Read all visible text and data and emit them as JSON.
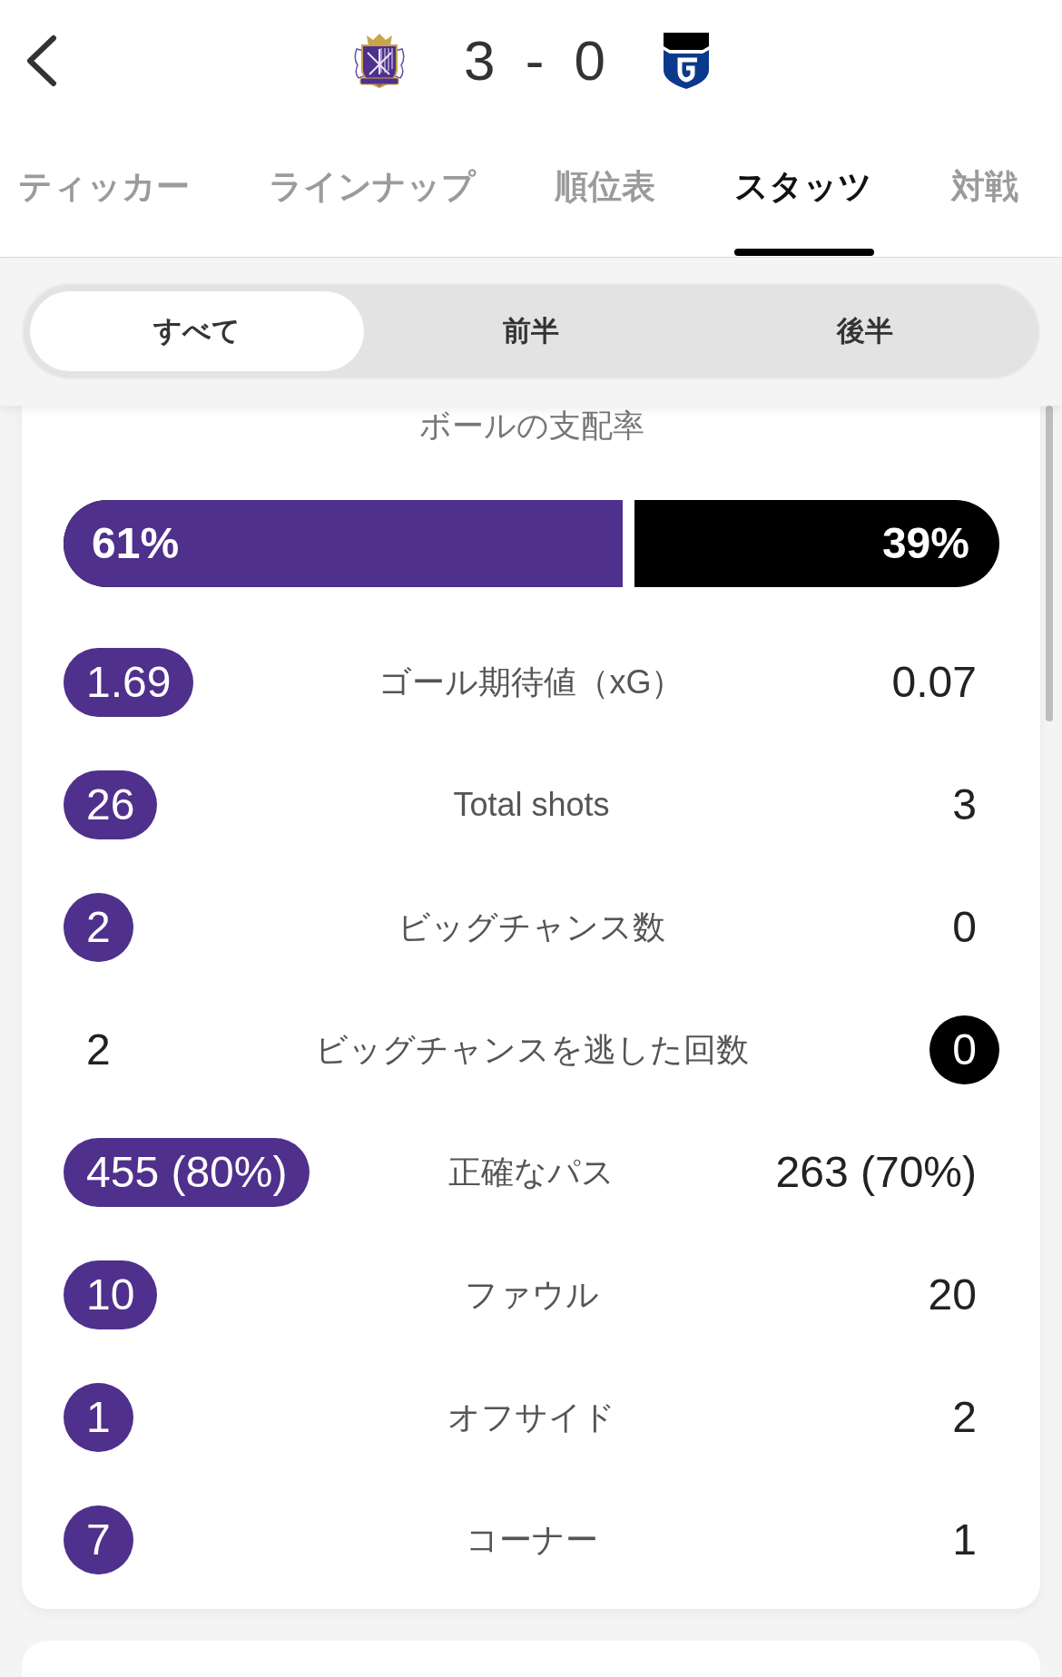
{
  "score": "3 - 0",
  "tabs": [
    {
      "label": "ティッカー",
      "selected": false
    },
    {
      "label": "ラインナップ",
      "selected": false
    },
    {
      "label": "順位表",
      "selected": false
    },
    {
      "label": "スタッツ",
      "selected": true
    },
    {
      "label": "対戦",
      "selected": false
    }
  ],
  "period_filter": [
    {
      "label": "すべて",
      "selected": true
    },
    {
      "label": "前半",
      "selected": false
    },
    {
      "label": "後半",
      "selected": false
    }
  ],
  "possession": {
    "title": "ボールの支配率",
    "home": {
      "value": "61%",
      "level": 0.61
    },
    "away": {
      "value": "39%",
      "level": 0.39
    }
  },
  "stats": [
    {
      "label": "ゴール期待値（xG）",
      "home": "1.69",
      "away": "0.07",
      "home_highlighted": true,
      "away_highlighted": false
    },
    {
      "label": "Total shots",
      "home": "26",
      "away": "3",
      "home_highlighted": true,
      "away_highlighted": false
    },
    {
      "label": "ビッグチャンス数",
      "home": "2",
      "away": "0",
      "home_highlighted": true,
      "away_highlighted": false
    },
    {
      "label": "ビッグチャンスを逃した回数",
      "home": "2",
      "away": "0",
      "home_highlighted": false,
      "away_highlighted": true
    },
    {
      "label": "正確なパス",
      "home": "455 (80%)",
      "away": "263 (70%)",
      "home_highlighted": true,
      "away_highlighted": false
    },
    {
      "label": "ファウル",
      "home": "10",
      "away": "20",
      "home_highlighted": true,
      "away_highlighted": false
    },
    {
      "label": "オフサイド",
      "home": "1",
      "away": "2",
      "home_highlighted": true,
      "away_highlighted": false
    },
    {
      "label": "コーナー",
      "home": "7",
      "away": "1",
      "home_highlighted": true,
      "away_highlighted": false
    }
  ]
}
